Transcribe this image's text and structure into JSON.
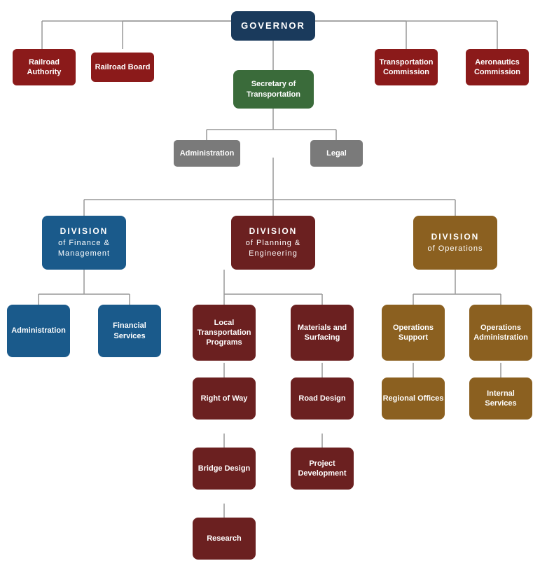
{
  "nodes": {
    "governor": {
      "label": "GOVERNOR"
    },
    "railroad_authority": {
      "label": "Railroad\nAuthority"
    },
    "railroad_board": {
      "label": "Railroad Board"
    },
    "transportation_commission": {
      "label": "Transportation\nCommission"
    },
    "aeronautics_commission": {
      "label": "Aeronautics\nCommission"
    },
    "secretary": {
      "label": "Secretary of\nTransportation"
    },
    "administration_top": {
      "label": "Administration"
    },
    "legal": {
      "label": "Legal"
    },
    "div_finance": {
      "label": "DIVISION\nof Finance &\nManagement"
    },
    "div_planning": {
      "label": "DIVISION\nof Planning &\nEngineering"
    },
    "div_operations": {
      "label": "DIVISION\nof Operations"
    },
    "administration_bottom": {
      "label": "Administration"
    },
    "financial_services": {
      "label": "Financial\nServices"
    },
    "local_transportation": {
      "label": "Local\nTransportation\nPrograms"
    },
    "materials_surfacing": {
      "label": "Materials and\nSurfacing"
    },
    "operations_support": {
      "label": "Operations\nSupport"
    },
    "operations_admin": {
      "label": "Operations\nAdministration"
    },
    "right_of_way": {
      "label": "Right of Way"
    },
    "road_design": {
      "label": "Road Design"
    },
    "regional_offices": {
      "label": "Regional Offices"
    },
    "internal_services": {
      "label": "Internal\nServices"
    },
    "bridge_design": {
      "label": "Bridge Design"
    },
    "project_development": {
      "label": "Project\nDevelopment"
    },
    "research": {
      "label": "Research"
    }
  }
}
